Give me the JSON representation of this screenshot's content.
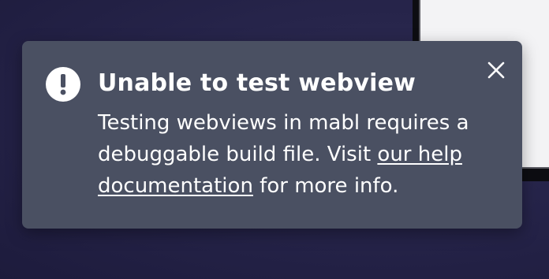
{
  "toast": {
    "icon": "exclamation-circle-icon",
    "title": "Unable to test webview",
    "message_before_link": "Testing webviews in mabl requires a debuggable build file. Visit ",
    "link_text": "our help documentation",
    "message_after_link": " for more info.",
    "close_icon": "close-icon",
    "colors": {
      "background": "#4a5062",
      "text": "#ffffff"
    }
  },
  "backdrop": {
    "colors": {
      "page": "#26244a",
      "window_frame": "#0d0d12",
      "window_content": "#f3f3f5"
    }
  }
}
